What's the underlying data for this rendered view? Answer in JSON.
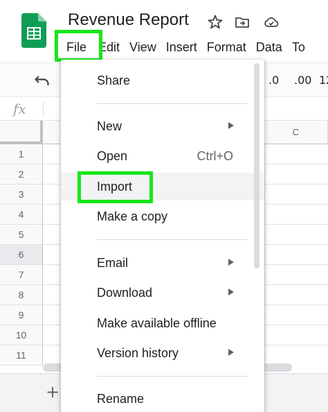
{
  "app": {
    "doc_title": "Revenue Report",
    "logo_icon": "sheets-logo-icon",
    "brand_color": "#0f9d58",
    "highlight_color": "#19e619"
  },
  "menubar": {
    "items": [
      "File",
      "Edit",
      "View",
      "Insert",
      "Format",
      "Data",
      "To"
    ]
  },
  "toolbar": {
    "decrease_decimal": ".0",
    "increase_decimal": ".00",
    "number_format": "12"
  },
  "formula_bar": {
    "fx_label": "fx"
  },
  "grid": {
    "columns": [
      "C"
    ],
    "rows": [
      "1",
      "2",
      "3",
      "4",
      "5",
      "6",
      "7",
      "8",
      "9",
      "10",
      "11"
    ],
    "selected_row": "6",
    "add_sheet_label": "+"
  },
  "file_menu": {
    "share": "Share",
    "new": "New",
    "open": "Open",
    "open_shortcut": "Ctrl+O",
    "import": "Import",
    "make_copy": "Make a copy",
    "email": "Email",
    "download": "Download",
    "offline": "Make available offline",
    "version_history": "Version history",
    "rename": "Rename",
    "hovered_item": "Import"
  }
}
